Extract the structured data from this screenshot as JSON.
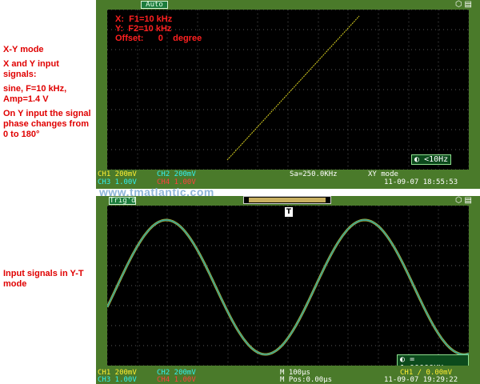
{
  "side_notes": {
    "xy": {
      "title": "X-Y mode",
      "desc1": "X and Y input signals:",
      "desc2": "sine, F=10 kHz, Amp=1.4 V",
      "desc3": "On Y input the signal phase changes from 0 to 180°"
    },
    "yt": {
      "title": "Input signals in Y-T mode"
    }
  },
  "watermark": "www.tmatlantic.com",
  "scope1": {
    "mode": "Auto",
    "icons": [
      "usb-icon",
      "printer-icon"
    ],
    "info": {
      "x": "X:  F1=10 kHz",
      "y": "Y:  F2=10 kHz",
      "offset": "Offset:      0    degree"
    },
    "freq": "<10Hz",
    "status": {
      "ch1": "CH1 200mV",
      "ch2": "CH2 200mV",
      "ch3": "CH3 1.00V",
      "ch4": "CH4 1.00V",
      "sa": "Sa=250.0KHz",
      "mode": "XY mode",
      "datetime": "11-09-07 18:55:53"
    },
    "colors": {
      "trace": "#d8d020",
      "grid": "#5a5a5a",
      "bezel": "#4a7a2a"
    }
  },
  "scope2": {
    "mode": "Trig'd",
    "icons": [
      "usb-icon",
      "printer-icon"
    ],
    "freq": "= 1.00000KHz",
    "trigger_marker": "T",
    "status": {
      "ch1": "CH1 200mV",
      "ch2": "CH2 200mV",
      "ch3": "CH3 1.00V",
      "ch4": "CH4 1.00V",
      "timebase": "M 100µs",
      "mpos": "M Pos:0.00µs",
      "trig": "CH1 / 0.00mV",
      "datetime": "11-09-07 19:29:22"
    },
    "colors": {
      "trace_ch1": "#b0b030",
      "trace_ch2": "#2aa0a0"
    }
  }
}
